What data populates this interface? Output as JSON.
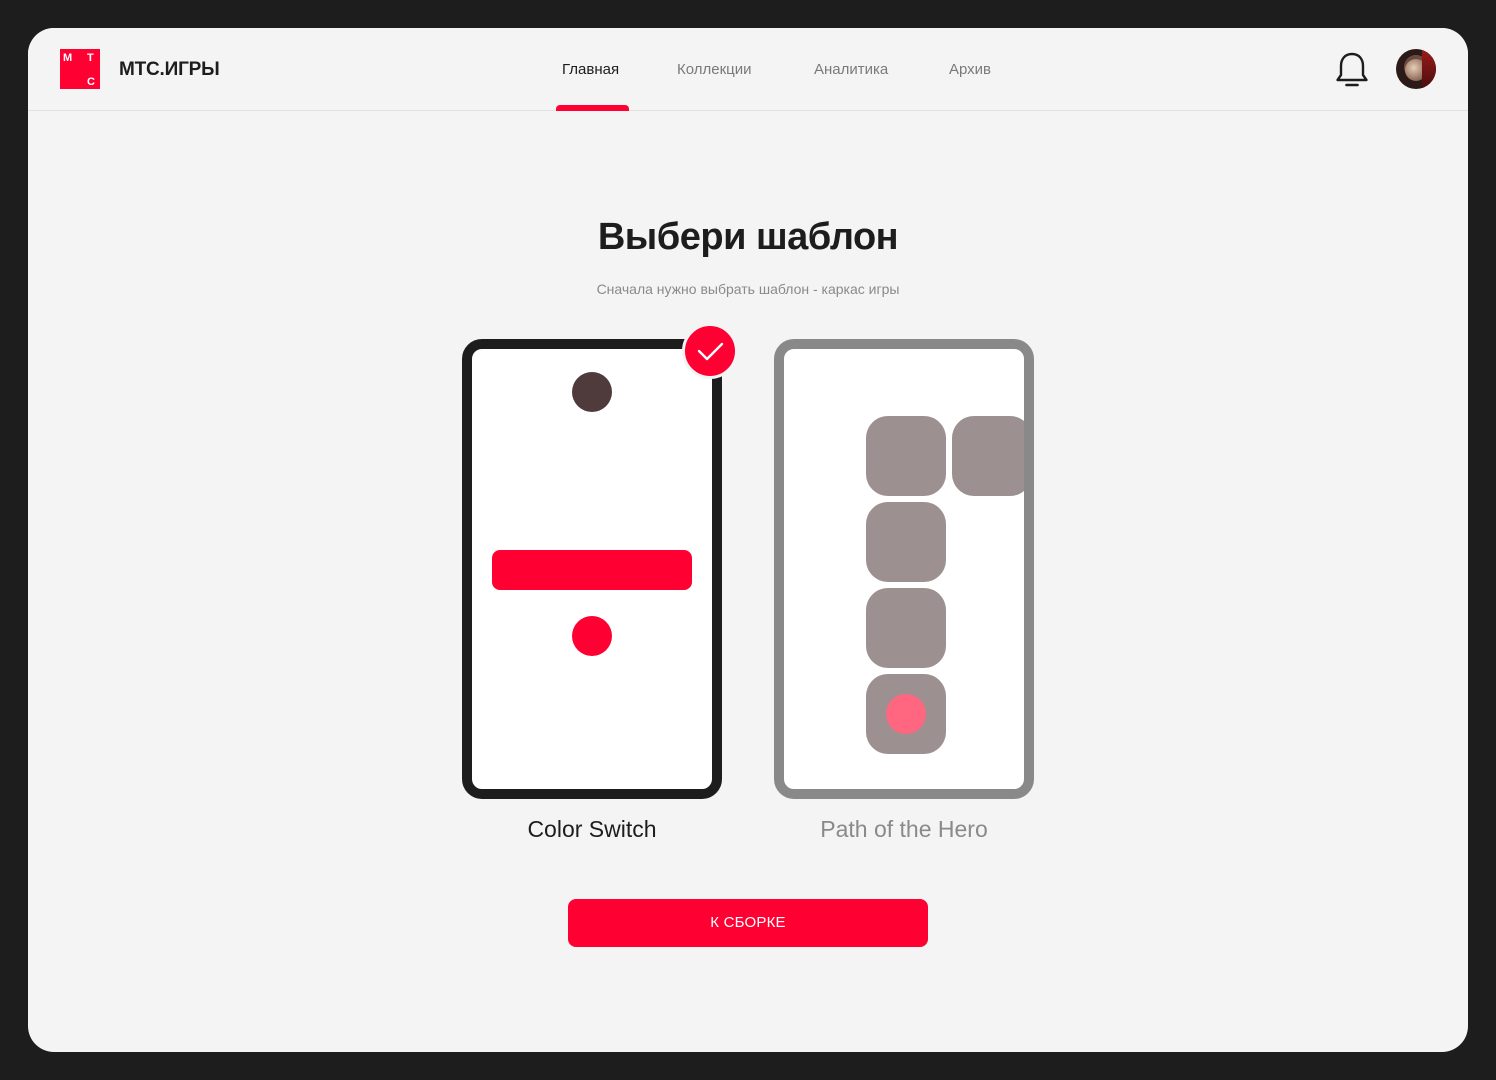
{
  "header": {
    "logo_letters": [
      "М",
      "Т",
      "С"
    ],
    "brand": "МТС.ИГРЫ",
    "nav": [
      {
        "label": "Главная",
        "active": true
      },
      {
        "label": "Коллекции",
        "active": false
      },
      {
        "label": "Аналитика",
        "active": false
      },
      {
        "label": "Архив",
        "active": false
      }
    ],
    "icons": [
      "bell-icon",
      "avatar"
    ]
  },
  "main": {
    "title": "Выбери шаблон",
    "subtitle": "Сначала нужно выбрать шаблон - каркас игры",
    "templates": [
      {
        "name": "Color Switch",
        "selected": true
      },
      {
        "name": "Path of the Hero",
        "selected": false
      }
    ],
    "cta_label": "К СБОРКЕ"
  },
  "colors": {
    "accent": "#ff0032",
    "dark": "#1d1d1d",
    "muted": "#8a8a8a",
    "tile": "#9c9091",
    "background": "#f4f4f4"
  }
}
